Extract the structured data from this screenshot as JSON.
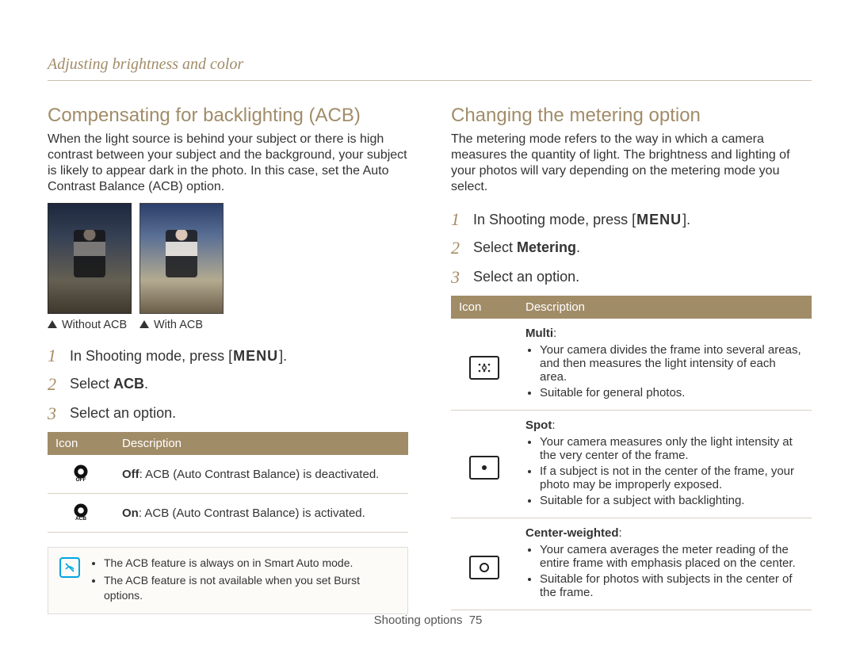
{
  "breadcrumb": "Adjusting brightness and color",
  "left": {
    "title": "Compensating for backlighting (ACB)",
    "intro": "When the light source is behind your subject or there is high contrast between your subject and the background, your subject is likely to appear dark in the photo. In this case, set the Auto Contrast Balance (ACB) option.",
    "captions": {
      "without": "Without ACB",
      "with": "With ACB"
    },
    "steps": [
      {
        "num": "1",
        "pre": "In Shooting mode, press [",
        "tag": "MENU",
        "post": "]."
      },
      {
        "num": "2",
        "pre": "Select ",
        "bold": "ACB",
        "post": "."
      },
      {
        "num": "3",
        "text": "Select an option."
      }
    ],
    "table": {
      "icon_hdr": "Icon",
      "desc_hdr": "Description",
      "rows": [
        {
          "icon": "off",
          "bold": "Off",
          "rest": ": ACB (Auto Contrast Balance) is deactivated."
        },
        {
          "icon": "on",
          "bold": "On",
          "rest": ": ACB (Auto Contrast Balance) is activated."
        }
      ]
    },
    "note": {
      "items": [
        "The ACB feature is always on in Smart Auto mode.",
        "The ACB feature is not available when you set Burst options."
      ]
    }
  },
  "right": {
    "title": "Changing the metering option",
    "intro": "The metering mode refers to the way in which a camera measures the quantity of light. The brightness and lighting of your photos will vary depending on the metering mode you select.",
    "steps": [
      {
        "num": "1",
        "pre": "In Shooting mode, press [",
        "tag": "MENU",
        "post": "]."
      },
      {
        "num": "2",
        "pre": "Select ",
        "bold": "Metering",
        "post": "."
      },
      {
        "num": "3",
        "text": "Select an option."
      }
    ],
    "table": {
      "icon_hdr": "Icon",
      "desc_hdr": "Description",
      "rows": [
        {
          "icon": "multi",
          "title": "Multi",
          "bullets": [
            "Your camera divides the frame into several areas, and then measures the light intensity of each area.",
            "Suitable for general photos."
          ]
        },
        {
          "icon": "spot",
          "title": "Spot",
          "bullets": [
            "Your camera measures only the light intensity at the very center of the frame.",
            "If a subject is not in the center of the frame, your photo may be improperly exposed.",
            "Suitable for a subject with backlighting."
          ]
        },
        {
          "icon": "center",
          "title": "Center-weighted",
          "bullets": [
            "Your camera averages the meter reading of the entire frame with emphasis placed on the center.",
            "Suitable for photos with subjects in the center of the frame."
          ]
        }
      ]
    }
  },
  "footer": {
    "section": "Shooting options",
    "page": "75"
  }
}
